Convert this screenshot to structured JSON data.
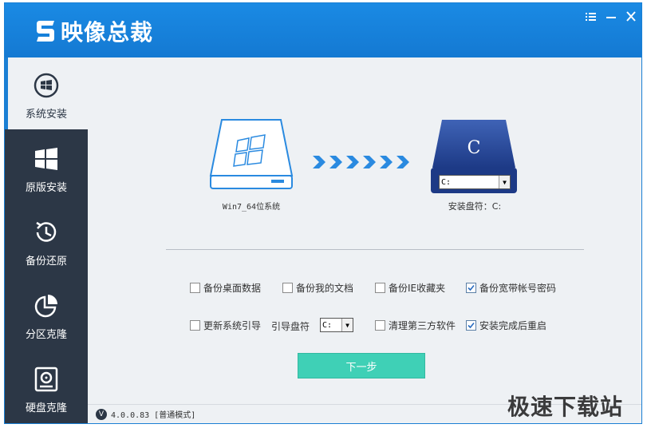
{
  "app": {
    "title": "映像总裁",
    "colors": {
      "titlebar": "#1a84dc",
      "sidebar": "#2c3746",
      "accent": "#1a7fd4",
      "next_button": "#3fd0b6"
    }
  },
  "window_controls": [
    {
      "name": "menu-icon"
    },
    {
      "name": "minimize-icon"
    },
    {
      "name": "close-icon"
    }
  ],
  "sidebar": {
    "items": [
      {
        "label": "系统安装",
        "icon": "windows-circle-icon",
        "active": true
      },
      {
        "label": "原版安装",
        "icon": "windows-logo-icon",
        "active": false
      },
      {
        "label": "备份还原",
        "icon": "history-clock-icon",
        "active": false
      },
      {
        "label": "分区克隆",
        "icon": "pie-chart-icon",
        "active": false
      },
      {
        "label": "硬盘克隆",
        "icon": "disk-icon",
        "active": false
      }
    ]
  },
  "main": {
    "source_label": "Win7_64位系统",
    "target_letter": "C",
    "target_select_value": "C:",
    "target_label": "安装盘符：C:",
    "options_row1": [
      {
        "label": "备份桌面数据",
        "checked": false
      },
      {
        "label": "备份我的文档",
        "checked": false
      },
      {
        "label": "备份IE收藏夹",
        "checked": false
      },
      {
        "label": "备份宽带帐号密码",
        "checked": true
      }
    ],
    "options_row2": {
      "update_boot": {
        "label": "更新系统引导",
        "checked": false
      },
      "boot_drive_label": "引导盘符",
      "boot_drive_value": "C:",
      "clean_third_party": {
        "label": "清理第三方软件",
        "checked": false
      },
      "restart_after": {
        "label": "安装完成后重启",
        "checked": true
      }
    },
    "next_label": "下一步"
  },
  "status": {
    "badge": "V",
    "version": "4.0.0.83 [普通模式]"
  },
  "watermark": "极速下载站"
}
